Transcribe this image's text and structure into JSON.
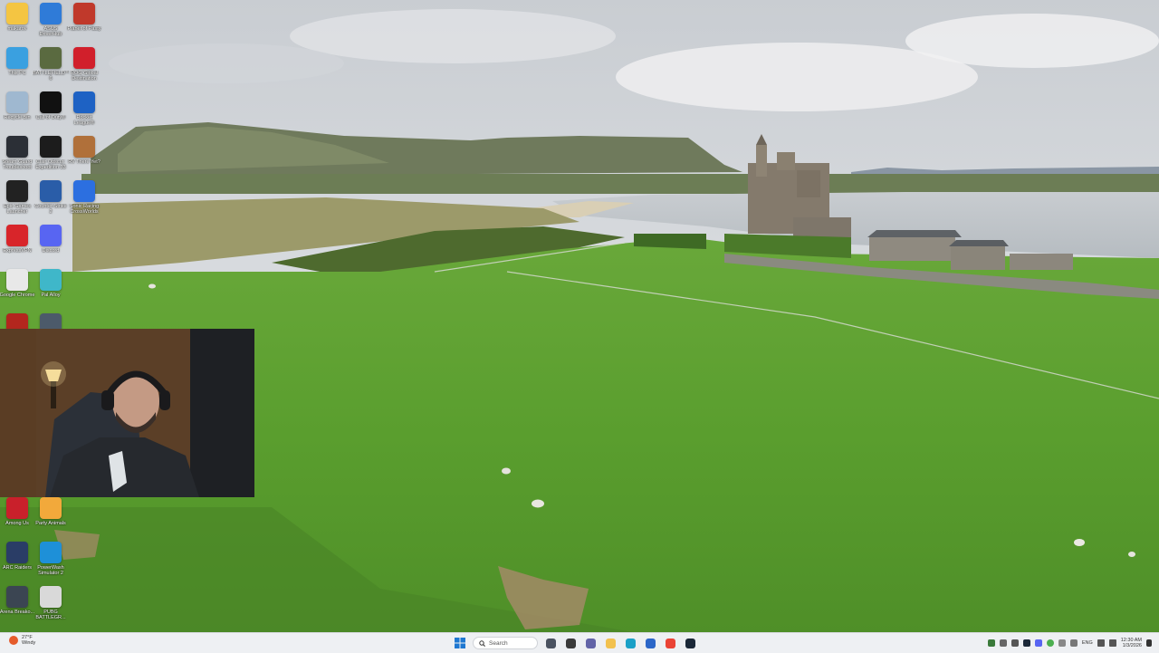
{
  "desktop": {
    "column1": [
      {
        "label": "makarov",
        "icon": "folder-icon",
        "color": "#f4c542"
      },
      {
        "label": "This PC",
        "icon": "monitor-icon",
        "color": "#3aa0e0"
      },
      {
        "label": "Recycle Bin",
        "icon": "recycle-bin-icon",
        "color": "#9fb8d0"
      },
      {
        "label": "Steam Guard Troubleshoot",
        "icon": "steam-icon",
        "color": "#2b2f36"
      },
      {
        "label": "Epic Games Launcher",
        "icon": "epic-games-icon",
        "color": "#222222"
      },
      {
        "label": "ExpressVPN",
        "icon": "expressvpn-icon",
        "color": "#d8252a"
      },
      {
        "label": "Google Chrome",
        "icon": "chrome-icon",
        "color": "#e8e8e8"
      },
      {
        "label": "GTA",
        "icon": "gta-icon",
        "color": "#b3261e"
      }
    ],
    "column2": [
      {
        "label": "ASUS DriverHub",
        "icon": "asus-driverhub-icon",
        "color": "#2f7bd8"
      },
      {
        "label": "BATTLEFIELD™ 6",
        "icon": "battlefield-icon",
        "color": "#5a6a40"
      },
      {
        "label": "Call of Duty®",
        "icon": "call-of-duty-icon",
        "color": "#111111"
      },
      {
        "label": "Clair Obscur: Expedition 33",
        "icon": "clair-obscur-icon",
        "color": "#1c1c1c"
      },
      {
        "label": "Counter-Strike 2",
        "icon": "counter-strike-icon",
        "color": "#2a5da8"
      },
      {
        "label": "Discord",
        "icon": "discord-icon",
        "color": "#5865f2"
      },
      {
        "label": "Pal Alloy",
        "icon": "palworld-icon",
        "color": "#3fb7c9"
      },
      {
        "label": "Game",
        "icon": "game-icon",
        "color": "#4c5a6a"
      }
    ],
    "column3": [
      {
        "label": "Planet of Pasty",
        "icon": "planet-pasty-icon",
        "color": "#c0392b"
      },
      {
        "label": "ROG Global Destination",
        "icon": "rog-icon",
        "color": "#d11f2b"
      },
      {
        "label": "Rocket League®",
        "icon": "rocket-league-icon",
        "color": "#1e62c4"
      },
      {
        "label": "RV There Yet?",
        "icon": "rv-there-yet-icon",
        "color": "#b0703a"
      },
      {
        "label": "Sonic Racing CrossWorlds",
        "icon": "sonic-racing-icon",
        "color": "#2c6fe0"
      }
    ],
    "bottom_column1": [
      {
        "label": "Among Us",
        "icon": "among-us-icon",
        "color": "#c9202b"
      },
      {
        "label": "ARC Raiders",
        "icon": "arc-raiders-icon",
        "color": "#2a3d66"
      },
      {
        "label": "Arena Breako...",
        "icon": "arena-breakout-icon",
        "color": "#3b4552"
      }
    ],
    "bottom_column2": [
      {
        "label": "Party Animals",
        "icon": "party-animals-icon",
        "color": "#f2a93b"
      },
      {
        "label": "PowerWash Simulator 2",
        "icon": "powerwash-icon",
        "color": "#1e90d8"
      },
      {
        "label": "PUBG BATTLEGR...",
        "icon": "pubg-icon",
        "color": "#d9d9d9"
      }
    ]
  },
  "taskbar": {
    "weather": {
      "temp": "27°F",
      "condition": "Windy"
    },
    "search_placeholder": "Search",
    "apps": [
      {
        "name": "task-view-icon",
        "color": "#4a5260"
      },
      {
        "name": "file-manager-icon",
        "color": "#3a3a3a"
      },
      {
        "name": "teams-icon",
        "color": "#6264a7"
      },
      {
        "name": "file-explorer-icon",
        "color": "#f2c14e"
      },
      {
        "name": "edge-icon",
        "color": "#1aa0c7"
      },
      {
        "name": "store-icon",
        "color": "#2b66c8"
      },
      {
        "name": "chrome-icon",
        "color": "#ea4335"
      },
      {
        "name": "steam-icon",
        "color": "#1b2838"
      }
    ],
    "tray_language": "ENG",
    "clock_time": "12:30 AM",
    "clock_date": "1/3/2026"
  }
}
